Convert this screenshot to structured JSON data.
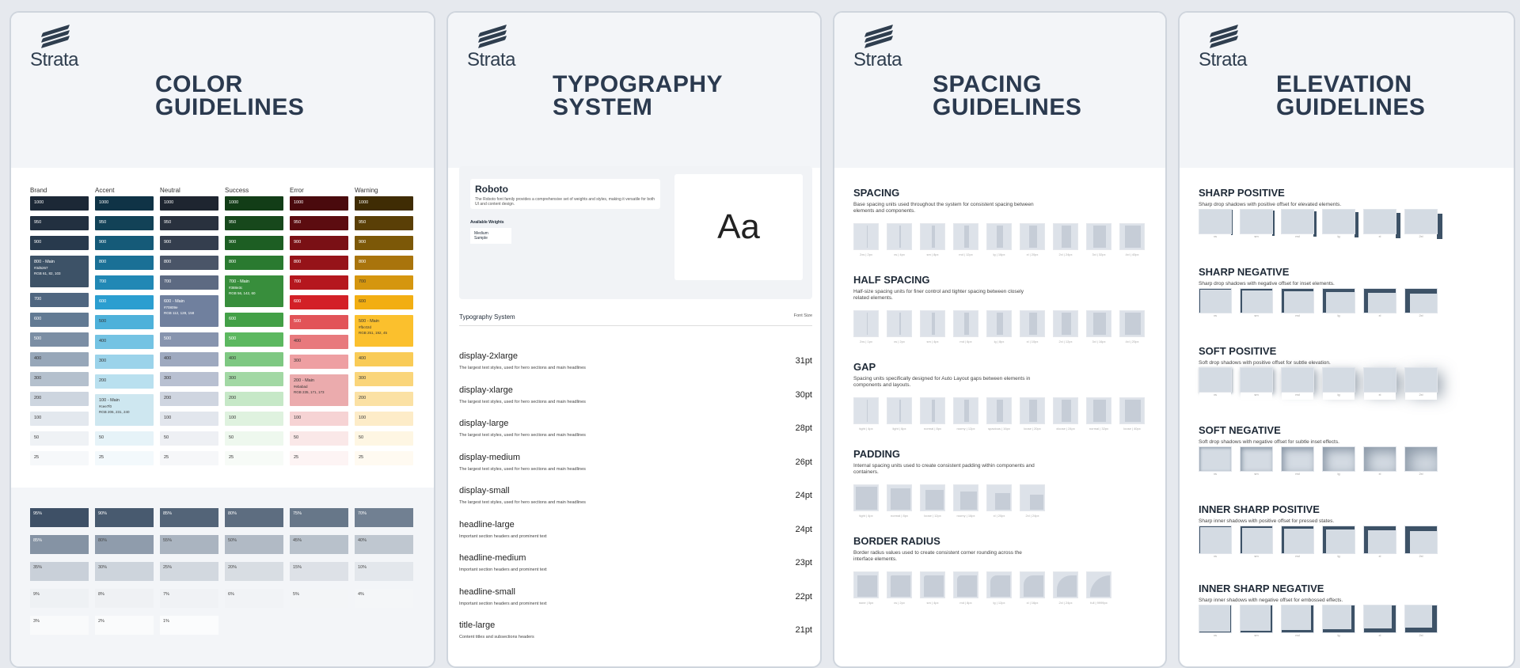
{
  "brand": "Strata",
  "boards": {
    "color": {
      "title_l1": "COLOR",
      "title_l2": "GUIDELINES"
    },
    "typography": {
      "title_l1": "TYPOGRAPHY",
      "title_l2": "SYSTEM"
    },
    "spacing": {
      "title_l1": "SPACING",
      "title_l2": "GUIDELINES"
    },
    "elevation": {
      "title_l1": "ELEVATION",
      "title_l2": "GUIDELINES"
    }
  },
  "palettes": [
    {
      "name": "Brand",
      "steps": [
        "1000",
        "950",
        "900",
        "800 - Main",
        "700",
        "600",
        "500",
        "400",
        "300",
        "200",
        "100",
        "50",
        "25"
      ],
      "main_index": 3,
      "main_hex": "#3d5267",
      "main_rgb": "RGB 61, 82, 103",
      "colors": [
        "#1c2836",
        "#223040",
        "#283a4d",
        "#3d5267",
        "#4f6680",
        "#627a93",
        "#7b8ea4",
        "#97a7b9",
        "#b4c0cd",
        "#cdd5df",
        "#e3e8ee",
        "#eff2f5",
        "#f6f8fa"
      ]
    },
    {
      "name": "Accent",
      "steps": [
        "1000",
        "950",
        "900",
        "800",
        "700",
        "600",
        "500",
        "400",
        "300",
        "200",
        "100 - Main",
        "50",
        "25"
      ],
      "main_index": 10,
      "main_hex": "#cee7f0",
      "main_rgb": "RGB 206, 231, 240",
      "colors": [
        "#0f3346",
        "#124257",
        "#155a78",
        "#1a7096",
        "#2188b5",
        "#2b9ed0",
        "#4eb1da",
        "#74c3e3",
        "#9bd3ea",
        "#b9e0ef",
        "#cee7f0",
        "#e6f3f8",
        "#f3f9fc"
      ]
    },
    {
      "name": "Neutral",
      "steps": [
        "1000",
        "950",
        "900",
        "800",
        "700",
        "600 - Main",
        "500",
        "400",
        "300",
        "200",
        "100",
        "50",
        "25"
      ],
      "main_index": 5,
      "main_hex": "#70809e",
      "main_rgb": "RGB 112, 128, 158",
      "colors": [
        "#1e2530",
        "#29313e",
        "#343e4e",
        "#4a5568",
        "#5d6a82",
        "#70809e",
        "#8794ae",
        "#9ea9bf",
        "#b8c0d1",
        "#cfd5e0",
        "#e2e6ed",
        "#eef0f4",
        "#f6f7f9"
      ]
    },
    {
      "name": "Success",
      "steps": [
        "1000",
        "950",
        "900",
        "800",
        "700 - Main",
        "600",
        "500",
        "400",
        "300",
        "200",
        "100",
        "50",
        "25"
      ],
      "main_index": 4,
      "main_hex": "#388e3c",
      "main_rgb": "RGB 56, 142, 60",
      "colors": [
        "#123d17",
        "#17481c",
        "#1d5e23",
        "#2a7a30",
        "#388e3c",
        "#43a047",
        "#5cb860",
        "#7ec882",
        "#a2d8a4",
        "#c6e8c7",
        "#dff2df",
        "#eef8ee",
        "#f7fbf7"
      ]
    },
    {
      "name": "Error",
      "steps": [
        "1000",
        "950",
        "900",
        "800",
        "700",
        "600",
        "500",
        "400",
        "300",
        "200 - Main",
        "100",
        "50",
        "25"
      ],
      "main_index": 9,
      "main_hex": "#ebabad",
      "main_rgb": "RGB 235, 171, 173",
      "colors": [
        "#4a0a0d",
        "#5c0c10",
        "#7a1015",
        "#961319",
        "#b5171e",
        "#d32027",
        "#e25358",
        "#e8797d",
        "#ee9fa2",
        "#ebabad",
        "#f6d3d4",
        "#fae8e8",
        "#fdf4f4"
      ]
    },
    {
      "name": "Warning",
      "steps": [
        "1000",
        "950",
        "900",
        "800",
        "700",
        "600",
        "500 - Main",
        "400",
        "300",
        "200",
        "100",
        "50",
        "25"
      ],
      "main_index": 6,
      "main_hex": "#fbc02d",
      "main_rgb": "RGB 251, 192, 45",
      "colors": [
        "#3f2c04",
        "#5a3f06",
        "#7c5808",
        "#a9740c",
        "#d5960f",
        "#f2ae12",
        "#fbc02d",
        "#f9cb56",
        "#fad57a",
        "#fbe1a4",
        "#fdecc8",
        "#fef6e3",
        "#fffaf1"
      ]
    }
  ],
  "opacity_columns": [
    {
      "values": [
        "95%",
        "85%",
        "35%",
        "9%",
        "3%"
      ],
      "colors": [
        "#3e5066",
        "#8593a4",
        "#c9d0d9",
        "#eef1f4",
        "#f9fafb"
      ]
    },
    {
      "values": [
        "90%",
        "80%",
        "30%",
        "8%",
        "2%"
      ],
      "colors": [
        "#485a6f",
        "#8f9cac",
        "#cdd4dc",
        "#eff1f4",
        "#fafbfc"
      ]
    },
    {
      "values": [
        "85%",
        "55%",
        "25%",
        "7%",
        "1%"
      ],
      "colors": [
        "#536478",
        "#aab4c0",
        "#d2d8df",
        "#f0f2f5",
        "#fbfcfd"
      ]
    },
    {
      "values": [
        "80%",
        "50%",
        "20%",
        "6%"
      ],
      "colors": [
        "#5d6d80",
        "#b1bac5",
        "#d8dde3",
        "#f1f3f6"
      ]
    },
    {
      "values": [
        "75%",
        "45%",
        "15%",
        "5%"
      ],
      "colors": [
        "#677789",
        "#b8c1cb",
        "#dde1e7",
        "#f3f5f7"
      ]
    },
    {
      "values": [
        "70%",
        "40%",
        "10%",
        "4%"
      ],
      "colors": [
        "#718092",
        "#bfc7d0",
        "#e3e7ec",
        "#f4f6f8"
      ]
    }
  ],
  "typography": {
    "font_name": "Roboto",
    "font_desc": "The Roboto font family provides a comprehensive set of weights and styles, making it versatile for both UI and content design.",
    "available_weights": "Available Weights",
    "weight_sample_l1": "Medium",
    "weight_sample_l2": "Sample",
    "aa": "Aa",
    "system_label": "Typography System",
    "font_size_label": "Font Size",
    "styles": [
      {
        "name": "display-2xlarge",
        "desc": "The largest text styles, used for hero sections and main headlines",
        "size": "31pt"
      },
      {
        "name": "display-xlarge",
        "desc": "The largest text styles, used for hero sections and main headlines",
        "size": "30pt"
      },
      {
        "name": "display-large",
        "desc": "The largest text styles, used for hero sections and main headlines",
        "size": "28pt"
      },
      {
        "name": "display-medium",
        "desc": "The largest text styles, used for hero sections and main headlines",
        "size": "26pt"
      },
      {
        "name": "display-small",
        "desc": "The largest text styles, used for hero sections and main headlines",
        "size": "24pt"
      },
      {
        "name": "headline-large",
        "desc": "Important section headers and prominent text",
        "size": "24pt"
      },
      {
        "name": "headline-medium",
        "desc": "Important section headers and prominent text",
        "size": "23pt"
      },
      {
        "name": "headline-small",
        "desc": "Important section headers and prominent text",
        "size": "22pt"
      },
      {
        "name": "title-large",
        "desc": "Content titles and subsections headers",
        "size": "21pt"
      }
    ]
  },
  "spacing": [
    {
      "title": "SPACING",
      "desc": "Base spacing units used throughout the system for consistent spacing between elements and components.",
      "labels": [
        "2xs | 2px",
        "xs | 4px",
        "sm | 8px",
        "md | 12px",
        "lg | 16px",
        "xl | 20px",
        "2xl | 24px",
        "3xl | 32px",
        "4xl | 40px"
      ]
    },
    {
      "title": "HALF SPACING",
      "desc": "Half-size spacing units for finer control and tighter spacing between closely related elements.",
      "labels": [
        "2xs | 1px",
        "xs | 2px",
        "sm | 4px",
        "md | 6px",
        "lg | 8px",
        "xl | 10px",
        "2xl | 12px",
        "3xl | 16px",
        "4xl | 20px"
      ]
    },
    {
      "title": "GAP",
      "desc": "Spacing units specifically designed for Auto Layout gaps between elements in components and layouts.",
      "labels": [
        "tight | 4px",
        "light | 6px",
        "normal | 8px",
        "roomy | 12px",
        "spacious | 16px",
        "loose | 20px",
        "xloose | 24px",
        "normal | 32px",
        "loose | 40px"
      ]
    },
    {
      "title": "PADDING",
      "desc": "Internal spacing units used to create consistent padding within components and containers.",
      "labels": [
        "tight | 4px",
        "normal | 8px",
        "loose | 12px",
        "roomy | 16px",
        "xl | 20px",
        "2xl | 24px"
      ]
    },
    {
      "title": "BORDER RADIUS",
      "desc": "Border radius values used to create consistent corner rounding across the interface elements.",
      "labels": [
        "none | 0px",
        "xs | 2px",
        "sm | 4px",
        "md | 8px",
        "lg | 12px",
        "xl | 16px",
        "2xl | 24px",
        "full | 9999px"
      ]
    }
  ],
  "elevation": [
    {
      "title": "SHARP POSITIVE",
      "desc": "Sharp drop shadows with positive offset for elevated elements.",
      "labels": [
        "xs",
        "sm",
        "md",
        "lg",
        "xl",
        "2xl"
      ]
    },
    {
      "title": "SHARP NEGATIVE",
      "desc": "Sharp drop shadows with negative offset for inset elements.",
      "labels": [
        "xs",
        "sm",
        "md",
        "lg",
        "xl",
        "2xl"
      ]
    },
    {
      "title": "SOFT POSITIVE",
      "desc": "Soft drop shadows with positive offset for subtle elevation.",
      "labels": [
        "xs",
        "sm",
        "md",
        "lg",
        "xl",
        "2xl"
      ]
    },
    {
      "title": "SOFT NEGATIVE",
      "desc": "Soft drop shadows with negative offset for subtle inset effects.",
      "labels": [
        "xs",
        "sm",
        "md",
        "lg",
        "xl",
        "2xl"
      ]
    },
    {
      "title": "INNER SHARP POSITIVE",
      "desc": "Sharp inner shadows with positive offset for pressed states.",
      "labels": [
        "xs",
        "sm",
        "md",
        "lg",
        "xl",
        "2xl"
      ]
    },
    {
      "title": "INNER SHARP NEGATIVE",
      "desc": "Sharp inner shadows with negative offset for embossed effects.",
      "labels": [
        "xs",
        "sm",
        "md",
        "lg",
        "xl",
        "2xl"
      ]
    }
  ]
}
